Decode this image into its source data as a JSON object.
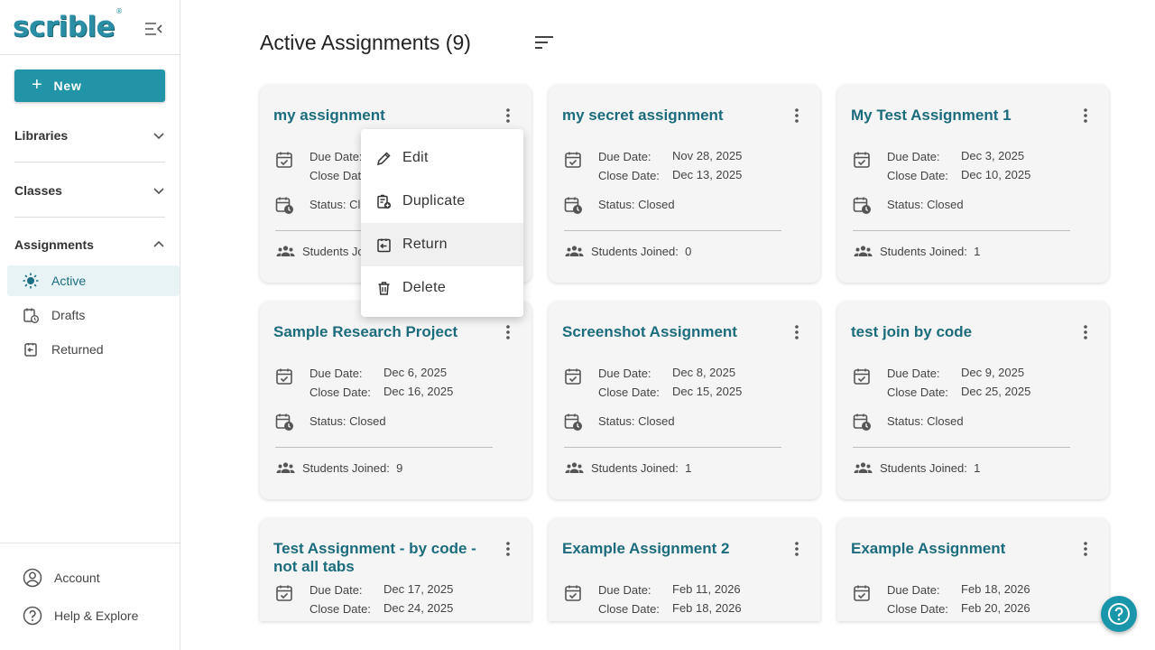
{
  "sidebar": {
    "logo": "scrible",
    "logo_mark": "®",
    "new_label": "New",
    "sections": [
      {
        "label": "Libraries",
        "expanded": false
      },
      {
        "label": "Classes",
        "expanded": false
      },
      {
        "label": "Assignments",
        "expanded": true
      }
    ],
    "assignment_items": [
      {
        "label": "Active",
        "icon": "sun-icon",
        "active": true
      },
      {
        "label": "Drafts",
        "icon": "draft-clock-icon",
        "active": false
      },
      {
        "label": "Returned",
        "icon": "return-icon",
        "active": false
      }
    ],
    "bottom": [
      {
        "label": "Account",
        "icon": "account-icon"
      },
      {
        "label": "Help & Explore",
        "icon": "help-icon"
      }
    ]
  },
  "main": {
    "title": "Active Assignments (9)",
    "labels": {
      "due": "Due Date:",
      "close": "Close Date:",
      "status": "Status:",
      "joined": "Students Joined:"
    },
    "cards": [
      {
        "title": "my assignment",
        "due": "",
        "close": "",
        "status": "Cl",
        "joined": ""
      },
      {
        "title": "my secret assignment",
        "due": "Nov 28, 2025",
        "close": "Dec 13, 2025",
        "status": "Closed",
        "joined": "0"
      },
      {
        "title": "My Test Assignment 1",
        "due": "Dec 3, 2025",
        "close": "Dec 10, 2025",
        "status": "Closed",
        "joined": "1"
      },
      {
        "title": "Sample Research Project",
        "due": "Dec 6, 2025",
        "close": "Dec 16, 2025",
        "status": "Closed",
        "joined": "9"
      },
      {
        "title": "Screenshot Assignment",
        "due": "Dec 8, 2025",
        "close": "Dec 15, 2025",
        "status": "Closed",
        "joined": "1"
      },
      {
        "title": "test join by code",
        "due": "Dec 9, 2025",
        "close": "Dec 25, 2025",
        "status": "Closed",
        "joined": "1"
      },
      {
        "title": "Test Assignment - by code - not all tabs",
        "due": "Dec 17, 2025",
        "close": "Dec 24, 2025",
        "status": "",
        "joined": ""
      },
      {
        "title": "Example Assignment 2",
        "due": "Feb 11, 2026",
        "close": "Feb 18, 2026",
        "status": "",
        "joined": ""
      },
      {
        "title": "Example Assignment",
        "due": "Feb 18, 2026",
        "close": "Feb 20, 2026",
        "status": "",
        "joined": ""
      }
    ],
    "card0_partial": {
      "due": "Due Date:",
      "close": "Close Dat",
      "status": "Status: Cl",
      "joined": "Students Joi"
    }
  },
  "context_menu": {
    "items": [
      {
        "label": "Edit",
        "icon": "pencil-icon"
      },
      {
        "label": "Duplicate",
        "icon": "duplicate-icon"
      },
      {
        "label": "Return",
        "icon": "return-icon"
      },
      {
        "label": "Delete",
        "icon": "trash-icon"
      }
    ]
  },
  "colors": {
    "accent": "#2194a8",
    "title": "#1b6c7c",
    "active_bg": "#e8f3f6"
  }
}
